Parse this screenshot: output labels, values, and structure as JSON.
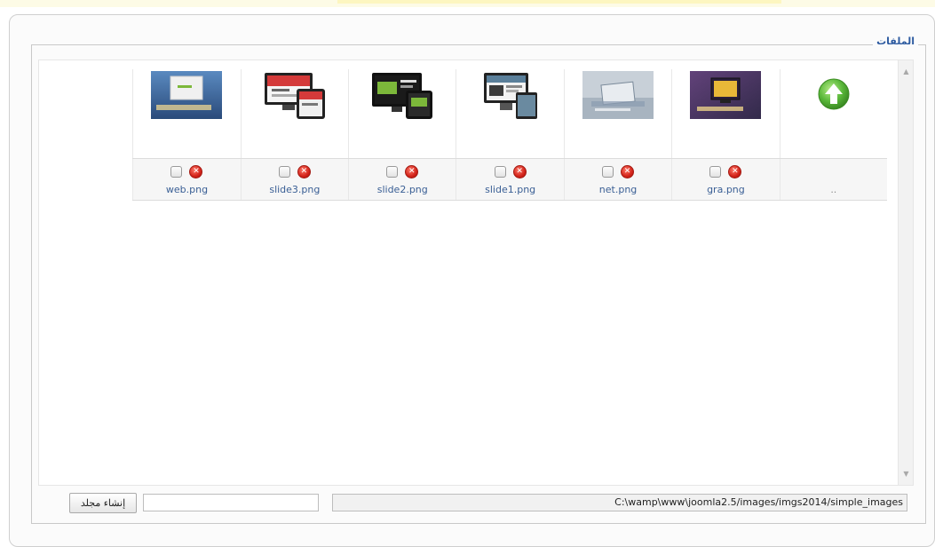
{
  "panel": {
    "title": "الملفات"
  },
  "files": [
    {
      "name": "..",
      "type": "folder-up",
      "icon": "arrow-up-icon",
      "color": "#5ab83a"
    },
    {
      "name": "gra.png",
      "type": "image",
      "bg": "#4a3a6a",
      "accent": "#e8b838"
    },
    {
      "name": "net.png",
      "type": "image",
      "bg": "#c8d0d8",
      "accent": "#8a9bb0"
    },
    {
      "name": "slide1.png",
      "type": "image",
      "bg": "#f2f2f2",
      "accent": "#5a7f9a"
    },
    {
      "name": "slide2.png",
      "type": "image",
      "bg": "#1a1a1a",
      "accent": "#7cb83a"
    },
    {
      "name": "slide3.png",
      "type": "image",
      "bg": "#f5f5f5",
      "accent": "#d43a3a"
    },
    {
      "name": "web.png",
      "type": "image",
      "bg": "#3a6aa0",
      "accent": "#f0f0f0"
    }
  ],
  "path": "C:\\wamp\\www\\joomla2.5/images/imgs2014/simple_images",
  "new_folder": {
    "value": "",
    "button_label": "إنشاء مجلد"
  },
  "colors": {
    "legend": "#2c5aa0",
    "filename": "#3a5f95",
    "delete": "#d2231a"
  }
}
